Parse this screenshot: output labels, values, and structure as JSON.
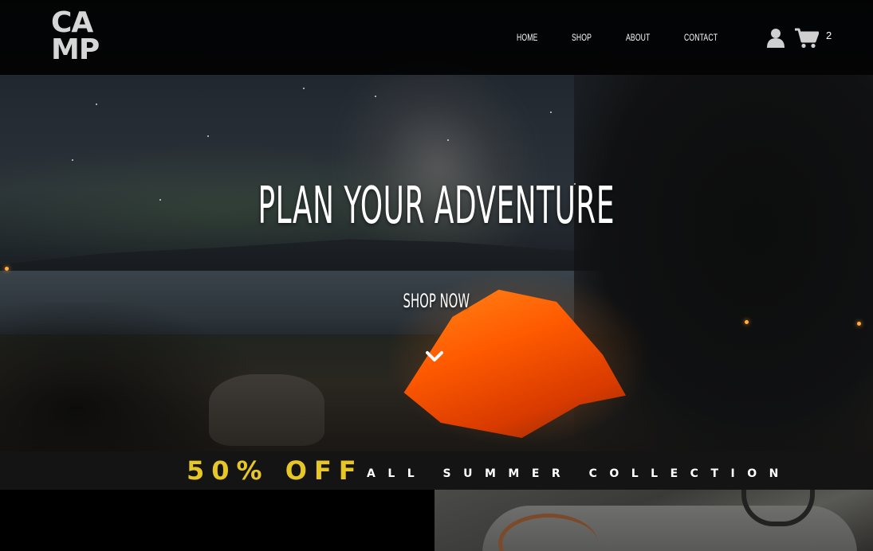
{
  "brand": {
    "logo_line1": "CA",
    "logo_line2": "MP"
  },
  "nav": {
    "items": [
      {
        "label": "HOME"
      },
      {
        "label": "SHOP"
      },
      {
        "label": "ABOUT"
      },
      {
        "label": "CONTACT"
      }
    ]
  },
  "header_icons": {
    "user": "user-icon",
    "cart": "cart-icon",
    "cart_count": "2"
  },
  "hero": {
    "title": "PLAN YOUR ADVENTURE",
    "cta_label": "SHOP NOW",
    "scroll_icon": "chevron-down-icon"
  },
  "promo": {
    "headline": "50% OFF",
    "subline": "ALL SUMMER COLLECTION",
    "accent_color": "#e7c628"
  }
}
